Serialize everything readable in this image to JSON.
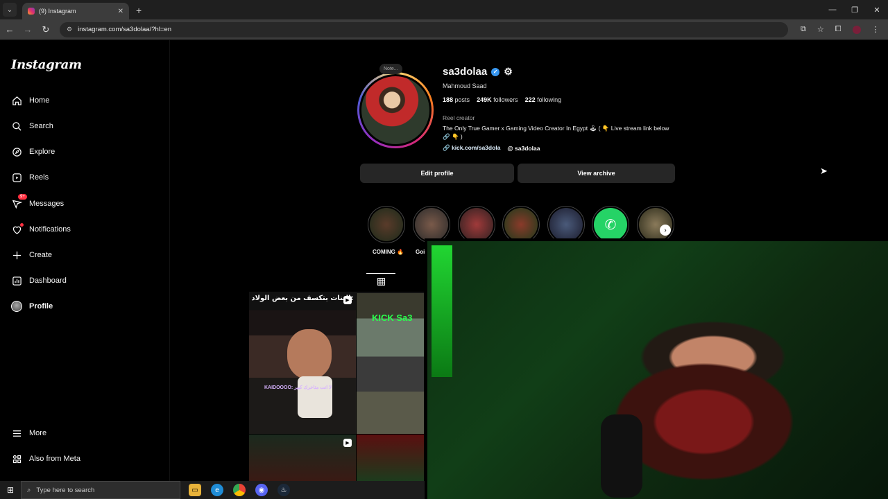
{
  "browser": {
    "tab_title": "(9) Instagram",
    "new_tab": "+",
    "url": "instagram.com/sa3dolaa/?hl=en"
  },
  "sidebar": {
    "logo": "Instagram",
    "items": [
      {
        "label": "Home"
      },
      {
        "label": "Search"
      },
      {
        "label": "Explore"
      },
      {
        "label": "Reels"
      },
      {
        "label": "Messages",
        "badge": "9+"
      },
      {
        "label": "Notifications"
      },
      {
        "label": "Create"
      },
      {
        "label": "Dashboard"
      },
      {
        "label": "Profile"
      }
    ],
    "more": "More",
    "also_from_meta": "Also from Meta"
  },
  "profile": {
    "note": "Note...",
    "username": "sa3dolaa",
    "full_name": "Mahmoud Saad",
    "posts_count": "188",
    "posts_label": "posts",
    "followers_count": "249K",
    "followers_label": "followers",
    "following_count": "222",
    "following_label": "following",
    "category": "Reel creator",
    "bio": "The Only True Gamer x Gaming Video Creator In Egypt 🕹 ( 👇 Live stream link below 🔗 👇 )",
    "link": "kick.com/sa3dola",
    "threads": "sa3dolaa",
    "edit_button": "Edit profile",
    "archive_button": "View archive"
  },
  "highlights": [
    {
      "label": "COMING 🔥"
    },
    {
      "label": "Goi"
    }
  ],
  "posts": {
    "post1_caption": "البنات بتكسف من بعض الولاد:",
    "post1_chat": "KAIDOOOO: لا انت متاخرك كبير",
    "post2_caption": "KICK Sa3"
  },
  "taskbar": {
    "search_placeholder": "Type here to search"
  }
}
